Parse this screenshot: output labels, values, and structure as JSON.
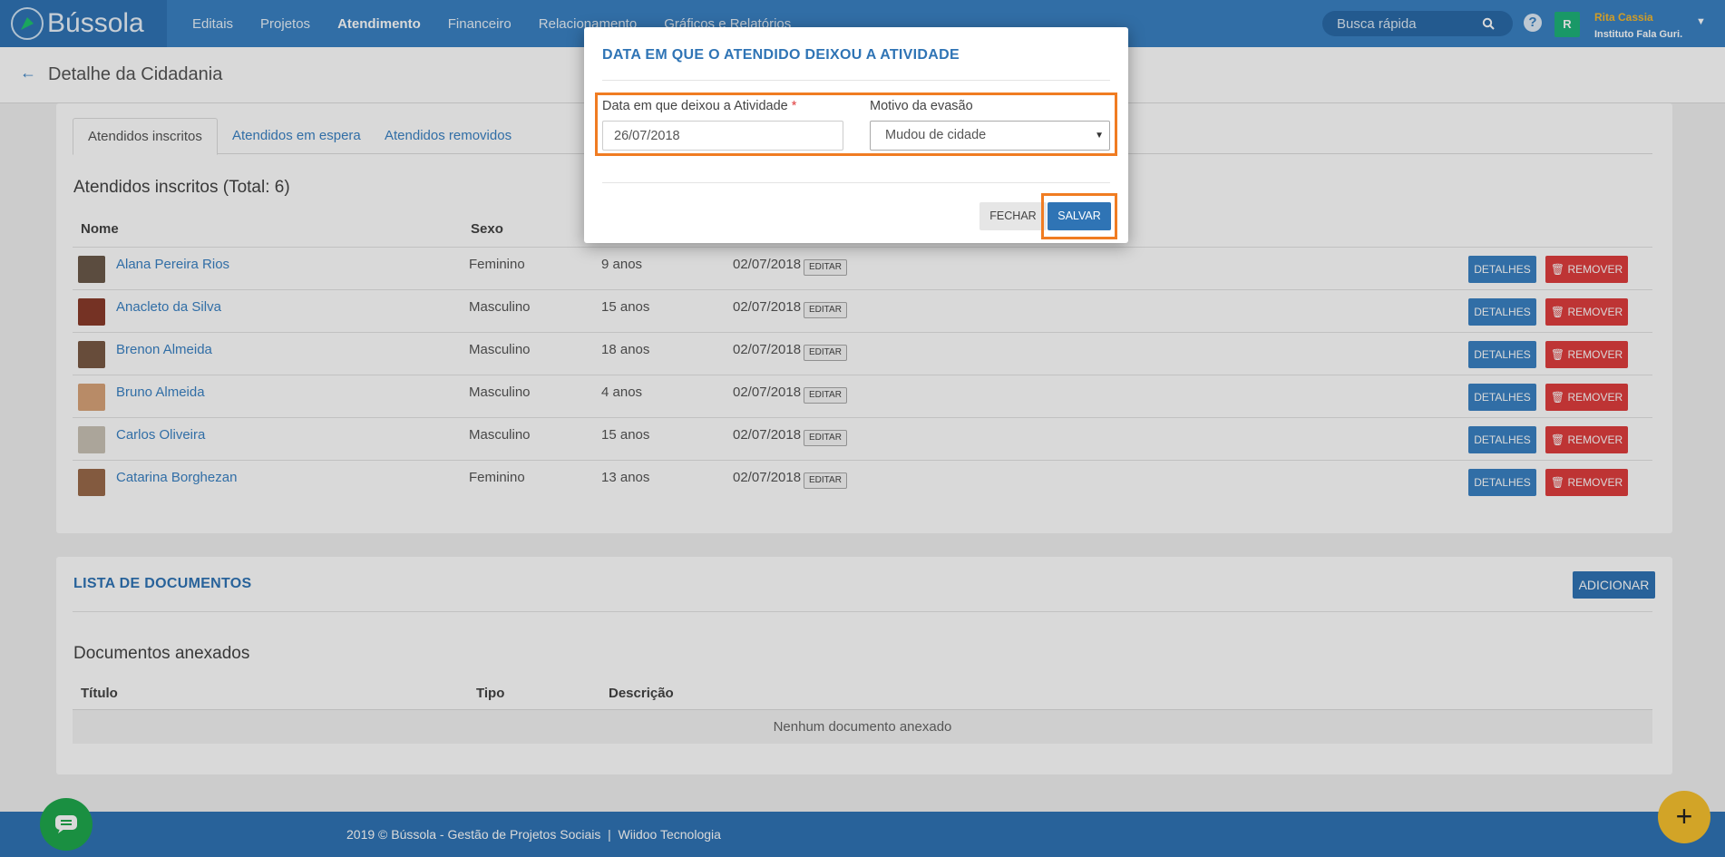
{
  "app": {
    "name": "Bússola"
  },
  "nav": {
    "items": [
      {
        "label": "Editais",
        "active": false
      },
      {
        "label": "Projetos",
        "active": false
      },
      {
        "label": "Atendimento",
        "active": true
      },
      {
        "label": "Financeiro",
        "active": false
      },
      {
        "label": "Relacionamento",
        "active": false
      },
      {
        "label": "Gráficos e Relatórios",
        "active": false
      }
    ],
    "search_placeholder": "Busca rápida",
    "help": "?",
    "avatar_initial": "R",
    "user_name": "Rita Cassia",
    "user_org": "Instituto Fala Guri."
  },
  "page": {
    "title": "Detalhe da Cidadania"
  },
  "tabs": [
    "Atendidos inscritos",
    "Atendidos em espera",
    "Atendidos removidos"
  ],
  "enrolled": {
    "heading": "Atendidos inscritos (Total: 6)",
    "columns": [
      "Nome",
      "Sexo"
    ],
    "rows": [
      {
        "name": "Alana Pereira Rios",
        "sex": "Feminino",
        "age": "9 anos",
        "date": "02/07/2018",
        "edit": "EDITAR",
        "details": "DETALHES",
        "remove": "REMOVER",
        "thumb": "#6b5a4a"
      },
      {
        "name": "Anacleto da Silva",
        "sex": "Masculino",
        "age": "15 anos",
        "date": "02/07/2018",
        "edit": "EDITAR",
        "details": "DETALHES",
        "remove": "REMOVER",
        "thumb": "#8a3b2b"
      },
      {
        "name": "Brenon Almeida",
        "sex": "Masculino",
        "age": "18 anos",
        "date": "02/07/2018",
        "edit": "EDITAR",
        "details": "DETALHES",
        "remove": "REMOVER",
        "thumb": "#7a5a45"
      },
      {
        "name": "Bruno Almeida",
        "sex": "Masculino",
        "age": "4 anos",
        "date": "02/07/2018",
        "edit": "EDITAR",
        "details": "DETALHES",
        "remove": "REMOVER",
        "thumb": "#d9a47a"
      },
      {
        "name": "Carlos Oliveira",
        "sex": "Masculino",
        "age": "15 anos",
        "date": "02/07/2018",
        "edit": "EDITAR",
        "details": "DETALHES",
        "remove": "REMOVER",
        "thumb": "#c9c2b5"
      },
      {
        "name": "Catarina Borghezan",
        "sex": "Feminino",
        "age": "13 anos",
        "date": "02/07/2018",
        "edit": "EDITAR",
        "details": "DETALHES",
        "remove": "REMOVER",
        "thumb": "#9a6a4a"
      }
    ]
  },
  "documents": {
    "title": "LISTA DE DOCUMENTOS",
    "add_label": "ADICIONAR",
    "subheading": "Documentos anexados",
    "columns": [
      "Título",
      "Tipo",
      "Descrição"
    ],
    "empty": "Nenhum documento anexado"
  },
  "footer": {
    "text": "2019 © Bússola - Gestão de Projetos Sociais  |  Wiidoo Tecnologia"
  },
  "modal": {
    "title": "DATA EM QUE O ATENDIDO DEIXOU A ATIVIDADE",
    "date_label": "Data em que deixou a Atividade",
    "required_mark": "*",
    "date_value": "26/07/2018",
    "reason_label": "Motivo da evasão",
    "reason_value": "Mudou de cidade",
    "close_label": "FECHAR",
    "save_label": "SALVAR"
  },
  "colors": {
    "primary": "#3a82c4",
    "danger": "#e03e3e",
    "highlight": "#f07c22",
    "fab": "#f7c12e",
    "chat": "#1fa84d"
  }
}
